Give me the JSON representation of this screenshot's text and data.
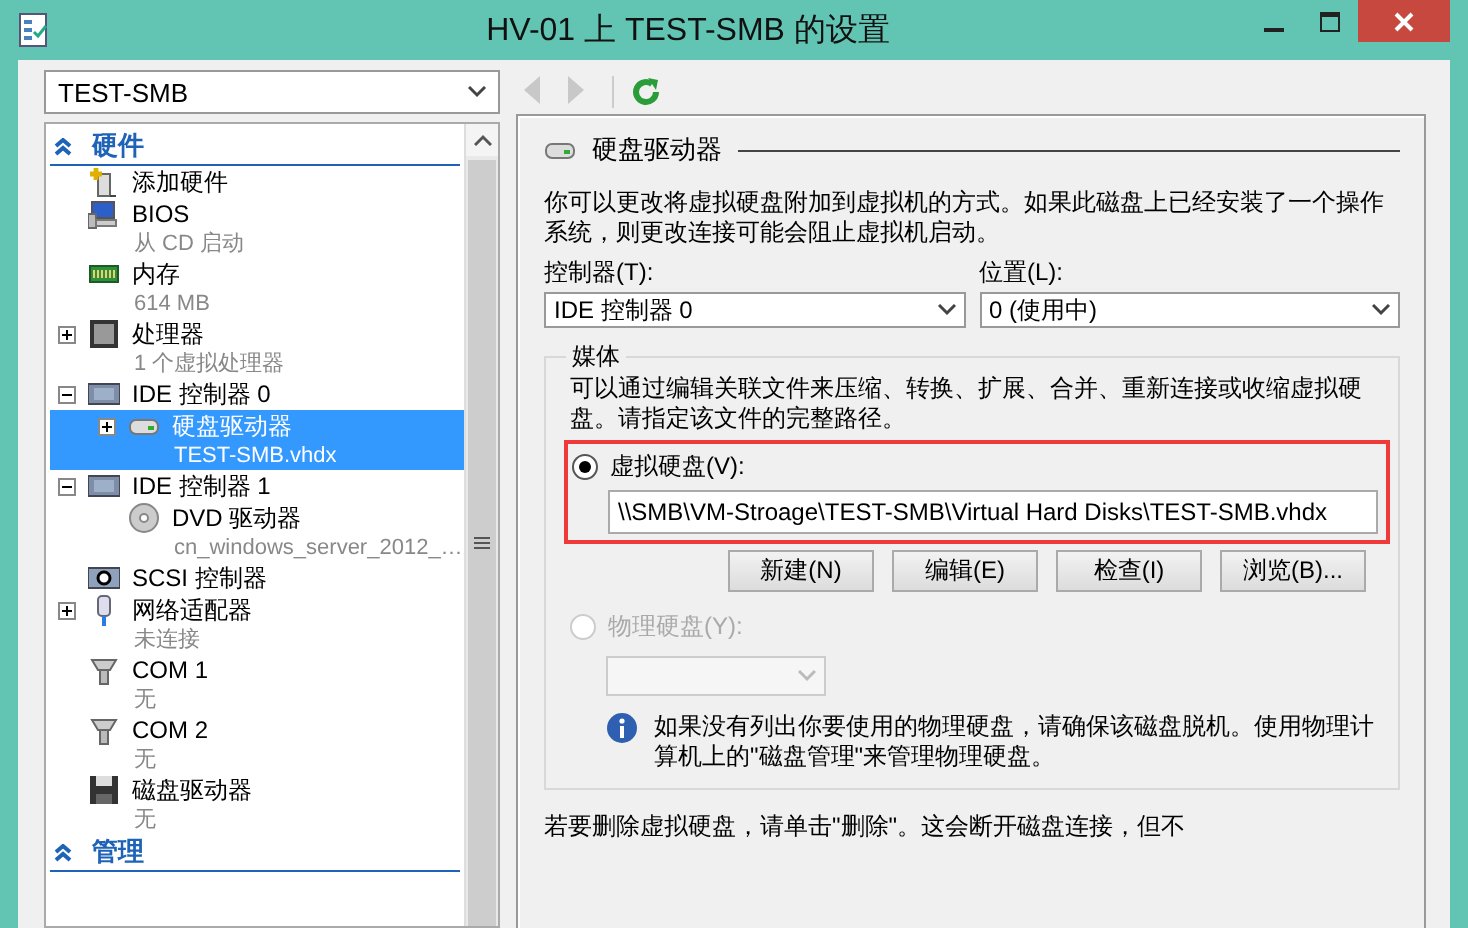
{
  "window": {
    "title": "HV-01 上 TEST-SMB 的设置"
  },
  "vm_selector": {
    "value": "TEST-SMB"
  },
  "tree": [
    {
      "kind": "section",
      "label": "硬件",
      "expanded": true,
      "children": [
        {
          "kind": "add",
          "label": "添加硬件",
          "selected": false
        },
        {
          "kind": "bios",
          "label": "BIOS",
          "detail": "从 CD 启动",
          "selected": false
        },
        {
          "kind": "memory",
          "label": "内存",
          "detail": "614 MB",
          "selected": false
        },
        {
          "kind": "cpu",
          "label": "处理器",
          "detail": "1 个虚拟处理器",
          "selected": false,
          "expanded": false
        },
        {
          "kind": "controller",
          "label": "IDE 控制器 0",
          "selected": false,
          "expanded": true,
          "children": [
            {
              "kind": "harddisk",
              "label": "硬盘驱动器",
              "detail": "TEST-SMB.vhdx",
              "selected": true,
              "expanded": false
            }
          ]
        },
        {
          "kind": "controller",
          "label": "IDE 控制器 1",
          "selected": false,
          "expanded": true,
          "children": [
            {
              "kind": "dvd",
              "label": "DVD 驱动器",
              "detail": "cn_windows_server_2012_…",
              "selected": false
            }
          ]
        },
        {
          "kind": "scsi",
          "label": "SCSI 控制器",
          "selected": false
        },
        {
          "kind": "network",
          "label": "网络适配器",
          "detail": "未连接",
          "selected": false,
          "expanded": false
        },
        {
          "kind": "com",
          "label": "COM 1",
          "detail": "无",
          "selected": false
        },
        {
          "kind": "com",
          "label": "COM 2",
          "detail": "无",
          "selected": false
        },
        {
          "kind": "floppy",
          "label": "磁盘驱动器",
          "detail": "无",
          "selected": false
        }
      ]
    },
    {
      "kind": "section",
      "label": "管理",
      "expanded": true
    }
  ],
  "panel": {
    "title": "硬盘驱动器",
    "description": "你可以更改将虚拟硬盘附加到虚拟机的方式。如果此磁盘上已经安装了一个操作系统，则更改连接可能会阻止虚拟机启动。",
    "controller": {
      "label": "控制器(T):",
      "value": "IDE 控制器 0"
    },
    "location": {
      "label": "位置(L):",
      "value": "0 (使用中)"
    },
    "media": {
      "title": "媒体",
      "description": "可以通过编辑关联文件来压缩、转换、扩展、合并、重新连接或收缩虚拟硬盘。请指定该文件的完整路径。",
      "virtual_disk": {
        "label": "虚拟硬盘(V):",
        "selected": true,
        "disabled": false,
        "highlighted": true,
        "path": "\\\\SMB\\VM-Stroage\\TEST-SMB\\Virtual Hard Disks\\TEST-SMB.vhdx"
      },
      "buttons": [
        "新建(N)",
        "编辑(E)",
        "检查(I)",
        "浏览(B)..."
      ],
      "physical_disk": {
        "label": "物理硬盘(Y):",
        "selected": false,
        "disabled": true
      },
      "info": "如果没有列出你要使用的物理硬盘，请确保该磁盘脱机。使用物理计算机上的\"磁盘管理\"来管理物理硬盘。"
    },
    "footer": "若要删除虚拟硬盘，请单击\"删除\"。这会断开磁盘连接，但不"
  }
}
